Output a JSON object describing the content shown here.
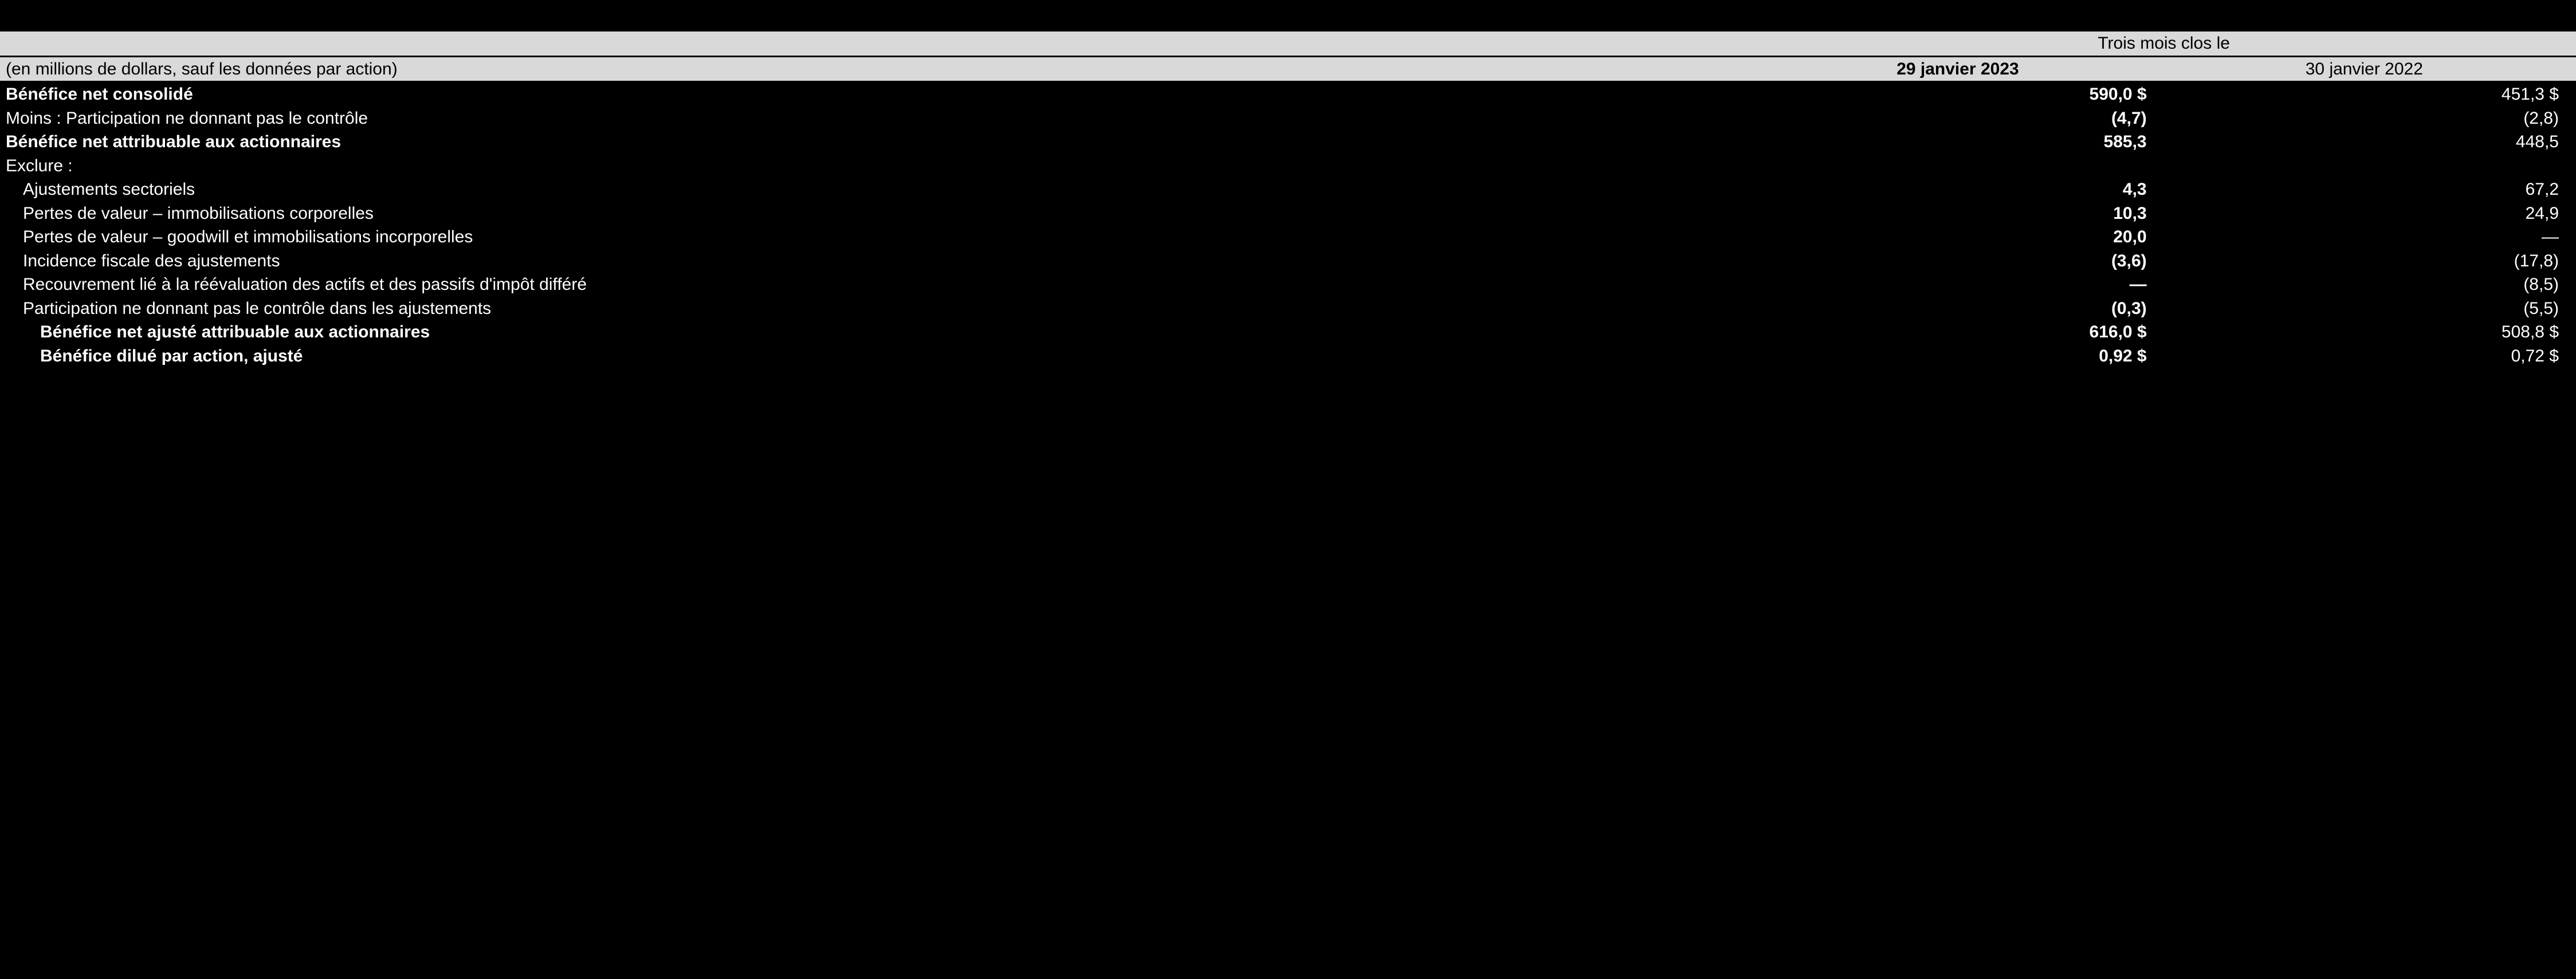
{
  "header": {
    "period_label": "Trois mois clos le",
    "units_note": "(en millions de dollars, sauf les données par action)",
    "col1": "29 janvier 2023",
    "col2": "30 janvier 2022"
  },
  "rows": [
    {
      "label": "Bénéfice net consolidé",
      "v1": "590,0 $",
      "v2": "451,3 $",
      "bold": true,
      "indent": 0
    },
    {
      "label": "Moins : Participation ne donnant pas le contrôle",
      "v1": "(4,7)",
      "v2": "(2,8)",
      "bold": false,
      "indent": 0
    },
    {
      "label": "Bénéfice net attribuable aux actionnaires",
      "v1": "585,3",
      "v2": "448,5",
      "bold": true,
      "indent": 0
    },
    {
      "label": "Exclure :",
      "v1": "",
      "v2": "",
      "bold": false,
      "indent": 0
    },
    {
      "label": "Ajustements sectoriels",
      "v1": "4,3",
      "v2": "67,2",
      "bold": false,
      "indent": 1
    },
    {
      "label": "Pertes de valeur – immobilisations corporelles",
      "v1": "10,3",
      "v2": "24,9",
      "bold": false,
      "indent": 1
    },
    {
      "label": "Pertes de valeur – goodwill et immobilisations incorporelles",
      "v1": "20,0",
      "v2": "—",
      "bold": false,
      "indent": 1
    },
    {
      "label": "Incidence fiscale des ajustements",
      "v1": "(3,6)",
      "v2": "(17,8)",
      "bold": false,
      "indent": 1
    },
    {
      "label": "Recouvrement lié à la réévaluation des actifs et des passifs d'impôt différé",
      "v1": "—",
      "v2": "(8,5)",
      "bold": false,
      "indent": 1
    },
    {
      "label": "Participation ne donnant pas le contrôle dans les ajustements",
      "v1": "(0,3)",
      "v2": "(5,5)",
      "bold": false,
      "indent": 1
    },
    {
      "label": "Bénéfice net ajusté attribuable aux actionnaires",
      "v1": "616,0 $",
      "v2": "508,8 $",
      "bold": true,
      "indent": 2
    },
    {
      "label": "Bénéfice dilué par action, ajusté",
      "v1": "0,92 $",
      "v2": "0,72 $",
      "bold": true,
      "indent": 2
    }
  ]
}
